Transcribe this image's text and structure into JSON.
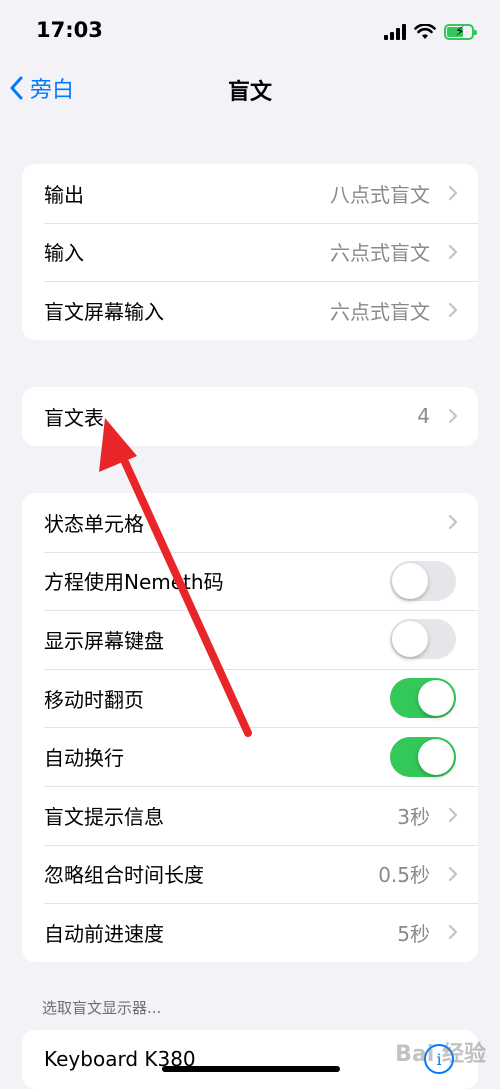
{
  "status_bar": {
    "time": "17:03"
  },
  "nav": {
    "back_label": "旁白",
    "title": "盲文"
  },
  "group1": {
    "rows": [
      {
        "label": "输出",
        "value": "八点式盲文"
      },
      {
        "label": "输入",
        "value": "六点式盲文"
      },
      {
        "label": "盲文屏幕输入",
        "value": "六点式盲文"
      }
    ]
  },
  "group2": {
    "rows": [
      {
        "label": "盲文表",
        "value": "4"
      }
    ]
  },
  "group3": {
    "rows": [
      {
        "label": "状态单元格"
      },
      {
        "label": "方程使用Nemeth码",
        "toggle": "off"
      },
      {
        "label": "显示屏幕键盘",
        "toggle": "off"
      },
      {
        "label": "移动时翻页",
        "toggle": "on"
      },
      {
        "label": "自动换行",
        "toggle": "on"
      },
      {
        "label": "盲文提示信息",
        "value": "3秒"
      },
      {
        "label": "忽略组合时间长度",
        "value": "0.5秒"
      },
      {
        "label": "自动前进速度",
        "value": "5秒"
      }
    ]
  },
  "section_header": "选取盲文显示器...",
  "group4": {
    "rows": [
      {
        "label": "Keyboard K380"
      }
    ]
  },
  "watermark": "Bai 经验",
  "colors": {
    "accent": "#007aff",
    "toggle_on": "#34c759",
    "annotation_arrow": "#e8262a"
  }
}
